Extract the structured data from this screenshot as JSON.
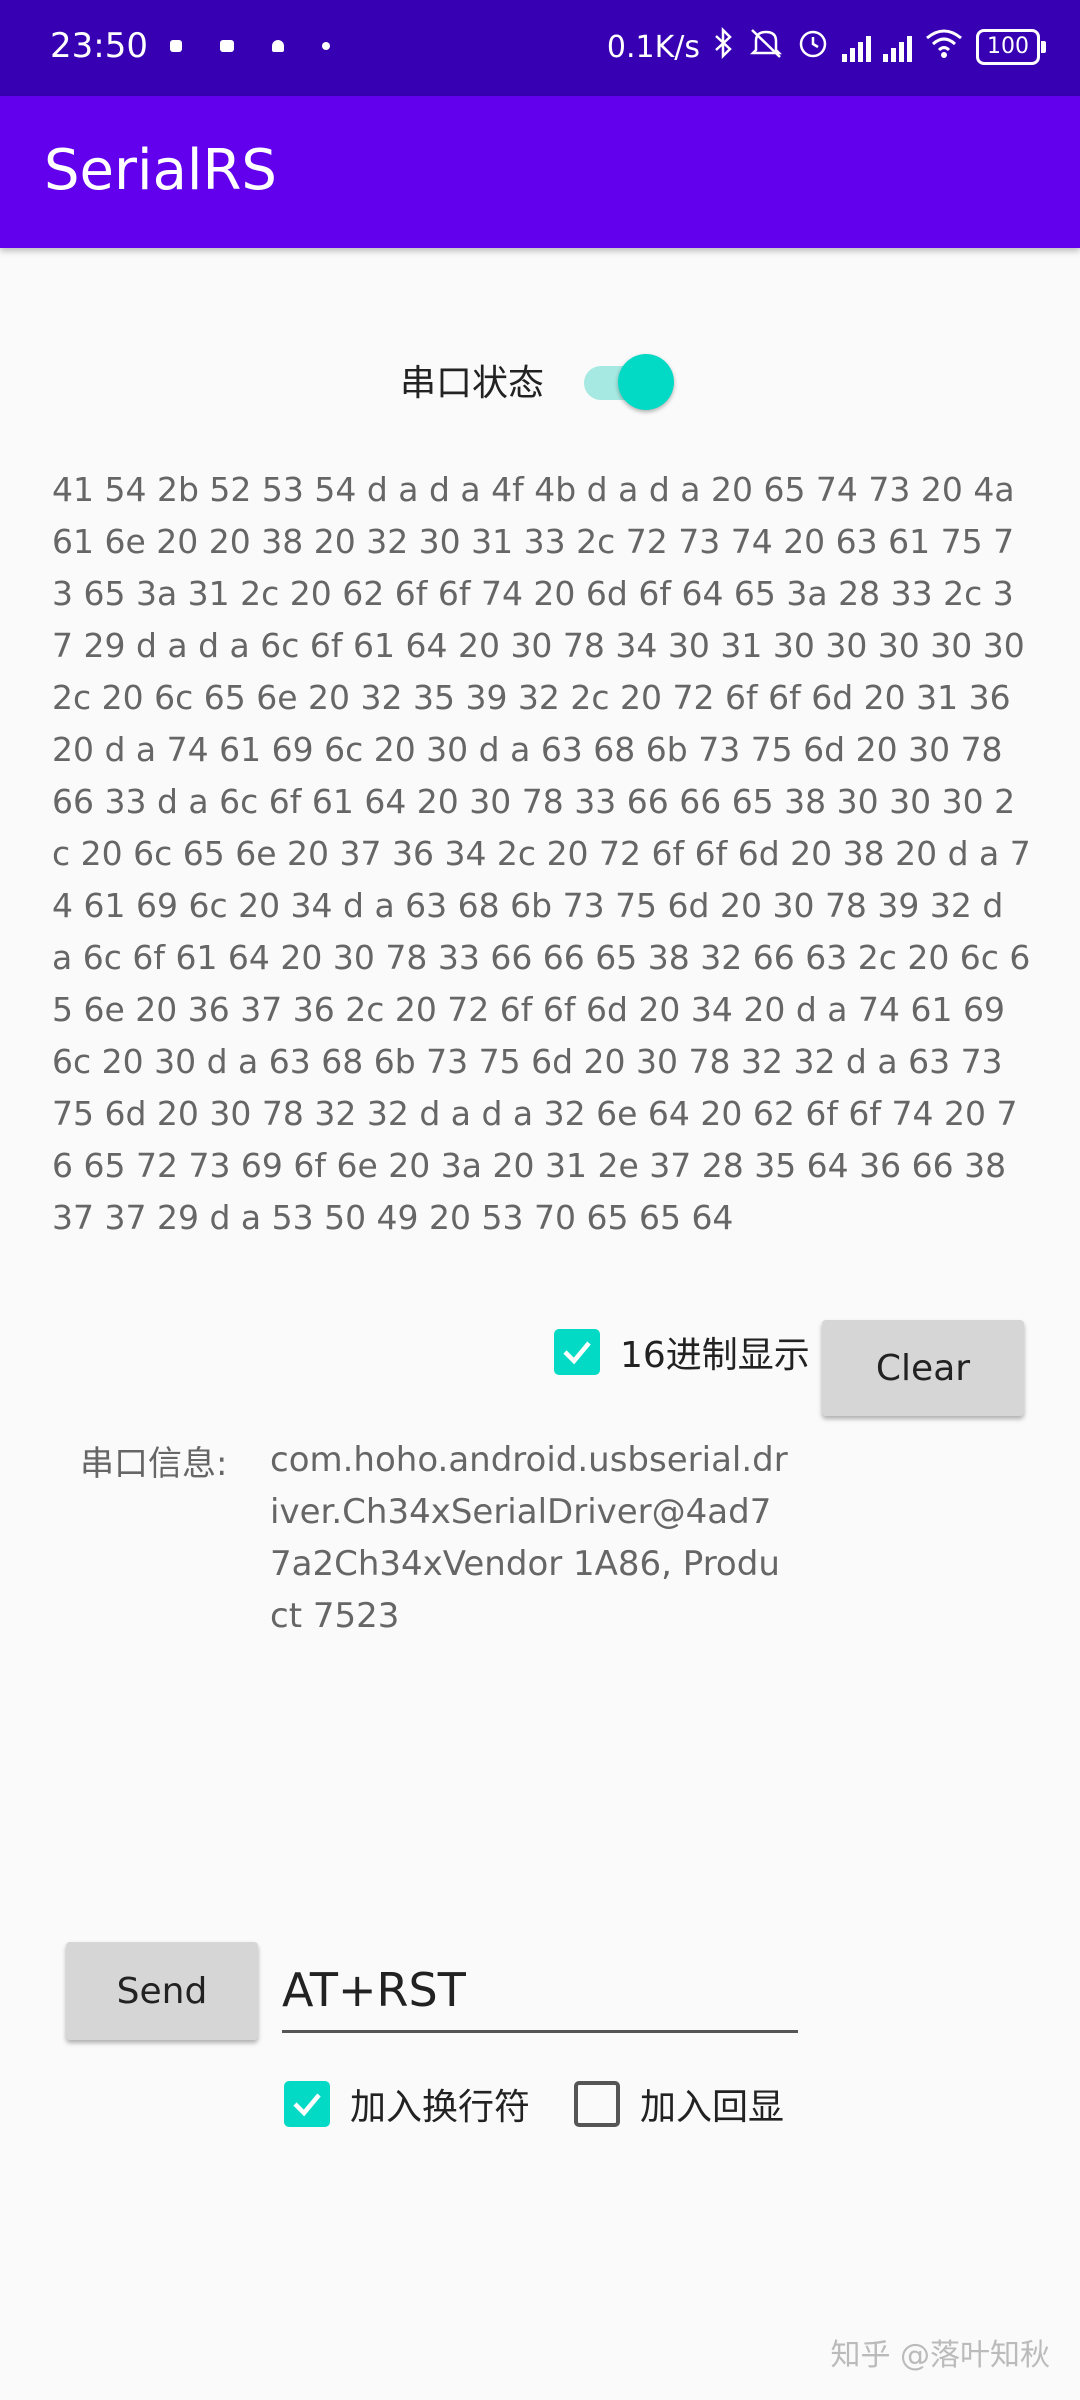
{
  "status_bar": {
    "time": "23:50",
    "network_speed": "0.1K/s",
    "battery": "100",
    "icons": [
      "notification-dot-icon",
      "bluetooth-icon",
      "mute-icon",
      "alarm-icon",
      "signal-hd-icon",
      "signal-hd-icon",
      "wifi-icon",
      "battery-icon"
    ]
  },
  "app_bar": {
    "title": "SerialRS"
  },
  "serial_status": {
    "label": "串口状态",
    "on": true
  },
  "output": {
    "hex_text": "41 54 2b 52 53 54 d a d a 4f 4b d a d a 20 65 74 73 20 4a 61 6e 20 20 38 20 32 30 31 33 2c 72 73 74 20 63 61 75 73 65 3a 31 2c 20 62 6f 6f 74 20 6d 6f 64 65 3a 28 33 2c 37 29 d a d a 6c 6f 61 64 20 30 78 34 30 31 30 30 30 30 30 2c 20 6c 65 6e 20 32 35 39 32 2c 20 72 6f 6f 6d 20 31 36 20 d a 74 61 69 6c 20 30 d a 63 68 6b 73 75 6d 20 30 78 66 33 d a 6c 6f 61 64 20 30 78 33 66 66 65 38 30 30 30 2c 20 6c 65 6e 20 37 36 34 2c 20 72 6f 6f 6d 20 38 20 d a 74 61 69 6c 20 34 d a 63 68 6b 73 75 6d 20 30 78 39 32 d a 6c 6f 61 64 20 30 78 33 66 66 65 38 32 66 63 2c 20 6c 65 6e 20 36 37 36 2c 20 72 6f 6f 6d 20 34 20 d a 74 61 69 6c 20 30 d a 63 68 6b 73 75 6d 20 30 78 32 32 d a 63 73 75 6d 20 30 78 32 32 d a d a 32 6e 64 20 62 6f 6f 74 20 76 65 72 73 69 6f 6e 20 3a 20 31 2e 37 28 35 64 36 66 38 37 37 29 d a 53 50 49 20 53 70 65 65 64"
  },
  "hex_display": {
    "label": "16进制显示",
    "checked": true
  },
  "clear_button": {
    "label": "Clear"
  },
  "port_info": {
    "label": "串口信息:",
    "value": "com.hoho.android.usbserial.driver.Ch34xSerialDriver@4ad77a2Ch34xVendor 1A86, Product 7523"
  },
  "send": {
    "button_label": "Send",
    "input_value": "AT+RST"
  },
  "options": {
    "newline": {
      "label": "加入换行符",
      "checked": true
    },
    "echo": {
      "label": "加入回显",
      "checked": false
    }
  },
  "watermark": "知乎 @落叶知秋",
  "colors": {
    "status_bar": "#3700b3",
    "app_bar": "#6200ee",
    "accent": "#03dac5",
    "background": "#fafafa",
    "button": "#d6d6d6"
  }
}
